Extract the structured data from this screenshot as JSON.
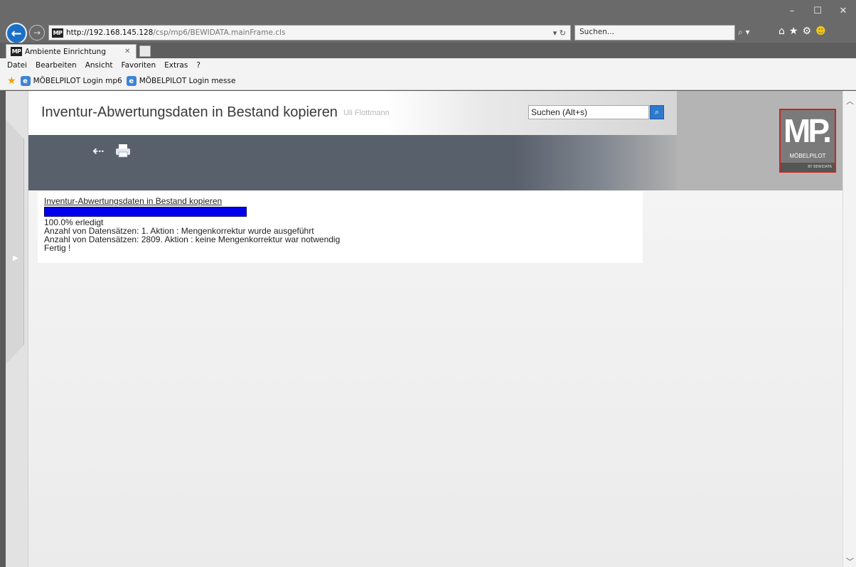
{
  "browser": {
    "url_host": "http://192.168.145.128",
    "url_path": "/csp/mp6/BEWIDATA.mainFrame.cls",
    "search_placeholder": "Suchen...",
    "tab_title": "Ambiente Einrichtung",
    "favicon_text": "MP",
    "menu": [
      "Datei",
      "Bearbeiten",
      "Ansicht",
      "Favoriten",
      "Extras",
      "?"
    ],
    "favorites": [
      "MÖBELPILOT Login mp6",
      "MÖBELPILOT Login messe"
    ],
    "icons": [
      "back-icon",
      "forward-icon",
      "refresh-icon",
      "search-icon",
      "home-icon",
      "star-icon",
      "gear-icon",
      "smiley-icon"
    ]
  },
  "page": {
    "title": "Inventur-Abwertungsdaten in Bestand kopieren",
    "user": "Uli Flottmann",
    "search_value": "Suchen (Alt+s)",
    "logo": {
      "mark": "MP.",
      "name": "MÖBELPILOT",
      "by": "BY BEWIDATA"
    }
  },
  "progress": {
    "title": "Inventur-Abwertungsdaten in Bestand kopieren",
    "percent": 100.0,
    "percent_label": "100.0% erledigt",
    "lines": [
      "Anzahl von Datensätzen: 1. Aktion : Mengenkorrektur wurde ausgeführt",
      "Anzahl von Datensätzen: 2809. Aktion : keine Mengenkorrektur war notwendig"
    ],
    "done": "Fertig !"
  },
  "colors": {
    "progress": "#0000ee",
    "accent": "#2f79cc",
    "logo_border": "#c8261d"
  }
}
